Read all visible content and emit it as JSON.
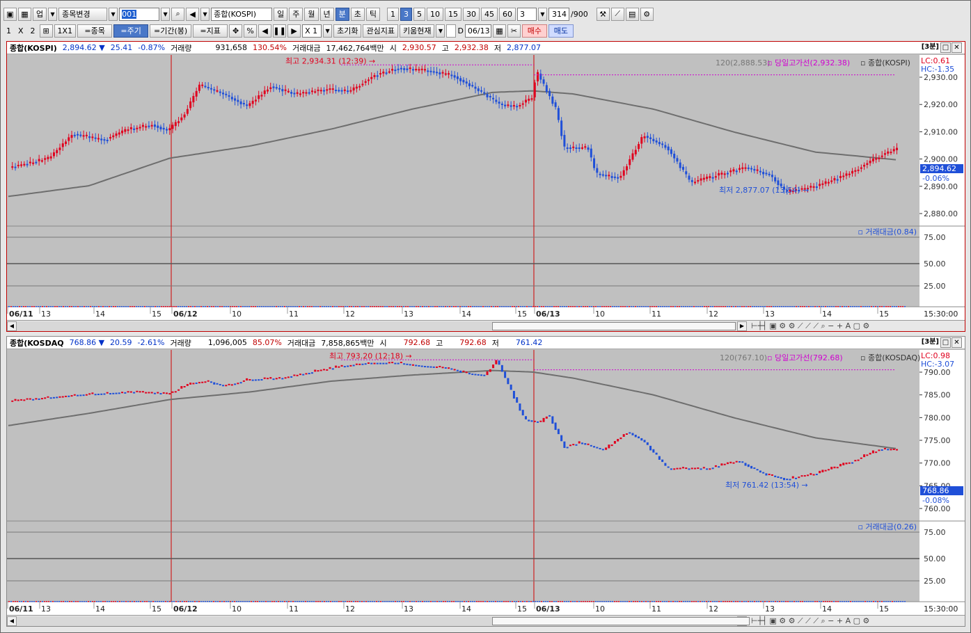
{
  "toolbar1": {
    "market_label": "업",
    "symbol_change": "종목변경",
    "code_value": "001",
    "name_value": "종합(KOSPI)",
    "periods": [
      "일",
      "주",
      "월",
      "년",
      "분",
      "초",
      "틱"
    ],
    "selected_period": "분",
    "minutes": [
      "1",
      "3",
      "5",
      "10",
      "15",
      "30",
      "45",
      "60"
    ],
    "selected_minute": "3",
    "interval_value": "3",
    "count_value": "314",
    "count_total": "/900"
  },
  "toolbar2": {
    "layout_1": "1",
    "layout_x": "X",
    "layout_2": "2",
    "ratio_label": "1X1",
    "btn_symbol": "=종목",
    "btn_period": "=주기",
    "btn_range": "=기간(봉)",
    "btn_indicator": "=지표",
    "zoom_value": "X 1",
    "reset": "초기화",
    "watch_indicator": "관심지표",
    "kiwoom_current": "키움현재",
    "date_checkbox_label": "D",
    "date_value": "06/13",
    "buy": "매수",
    "sell": "매도"
  },
  "panels": [
    {
      "name": "종합(KOSPI)",
      "price": "2,894.62",
      "arrow": "▼",
      "change": "25.41",
      "change_pct": "-0.87%",
      "volume_label": "거래량",
      "volume": "931,658",
      "volume_pct": "130.54%",
      "amount_label": "거래대금",
      "amount": "17,462,764백만",
      "open_label": "시",
      "open": "2,930.57",
      "high_label": "고",
      "high": "2,932.38",
      "low_label": "저",
      "low": "2,877.07",
      "interval_badge": "[3분]",
      "legend_ma": "120(2,888.53)",
      "legend_line": "당일고가선(2,932.38)",
      "legend_name": "종합(KOSPI)",
      "lc": "LC:0.61",
      "hc": "HC:-1.35",
      "last_tag": "2,894.62",
      "last_pct": "-0.06%",
      "max_label": "최고 2,934.31 (12:39)",
      "min_label": "최저 2,877.07 (13:54)",
      "y_ticks": [
        "2,930.00",
        "2,920.00",
        "2,910.00",
        "2,900.00",
        "2,890.00",
        "2,880.00"
      ],
      "sub_label": "거래대금(0.84)",
      "sub_ticks": [
        "75.00",
        "50.00",
        "25.00"
      ],
      "x_labels": [
        "06/11",
        "13",
        "14",
        "15",
        "06/12",
        "10",
        "11",
        "12",
        "13",
        "14",
        "15",
        "06/13",
        "10",
        "11",
        "12",
        "13",
        "14",
        "15"
      ],
      "time_label": "15:30:00"
    },
    {
      "name": "종합(KOSDAQ",
      "price": "768.86",
      "arrow": "▼",
      "change": "20.59",
      "change_pct": "-2.61%",
      "volume_label": "거래량",
      "volume": "1,096,005",
      "volume_pct": "85.07%",
      "amount_label": "거래대금",
      "amount": "7,858,865백만",
      "open_label": "시",
      "open": "792.68",
      "high_label": "고",
      "high": "792.68",
      "low_label": "저",
      "low": "761.42",
      "interval_badge": "[3분]",
      "legend_ma": "120(767.10)",
      "legend_line": "당일고가선(792.68)",
      "legend_name": "종합(KOSDAQ)",
      "lc": "LC:0.98",
      "hc": "HC:-3.07",
      "last_tag": "768.86",
      "last_pct": "-0.08%",
      "max_label": "최고 793.20 (12:18)",
      "min_label": "최저 761.42 (13:54)",
      "y_ticks": [
        "790.00",
        "785.00",
        "780.00",
        "775.00",
        "770.00",
        "765.00",
        "760.00"
      ],
      "sub_label": "거래대금(0.26)",
      "sub_ticks": [
        "75.00",
        "50.00",
        "25.00"
      ],
      "x_labels": [
        "06/11",
        "13",
        "14",
        "15",
        "06/12",
        "10",
        "11",
        "12",
        "13",
        "14",
        "15",
        "06/13",
        "10",
        "11",
        "12",
        "13",
        "14",
        "15"
      ],
      "time_label": "15:30:00"
    }
  ],
  "colors": {
    "up": "#e0001e",
    "down": "#1f4fd8",
    "ma": "#6e6e6e",
    "highline": "#d000d0",
    "chart_bg": "#c0c0c0",
    "day_separator": "#d00000"
  }
}
